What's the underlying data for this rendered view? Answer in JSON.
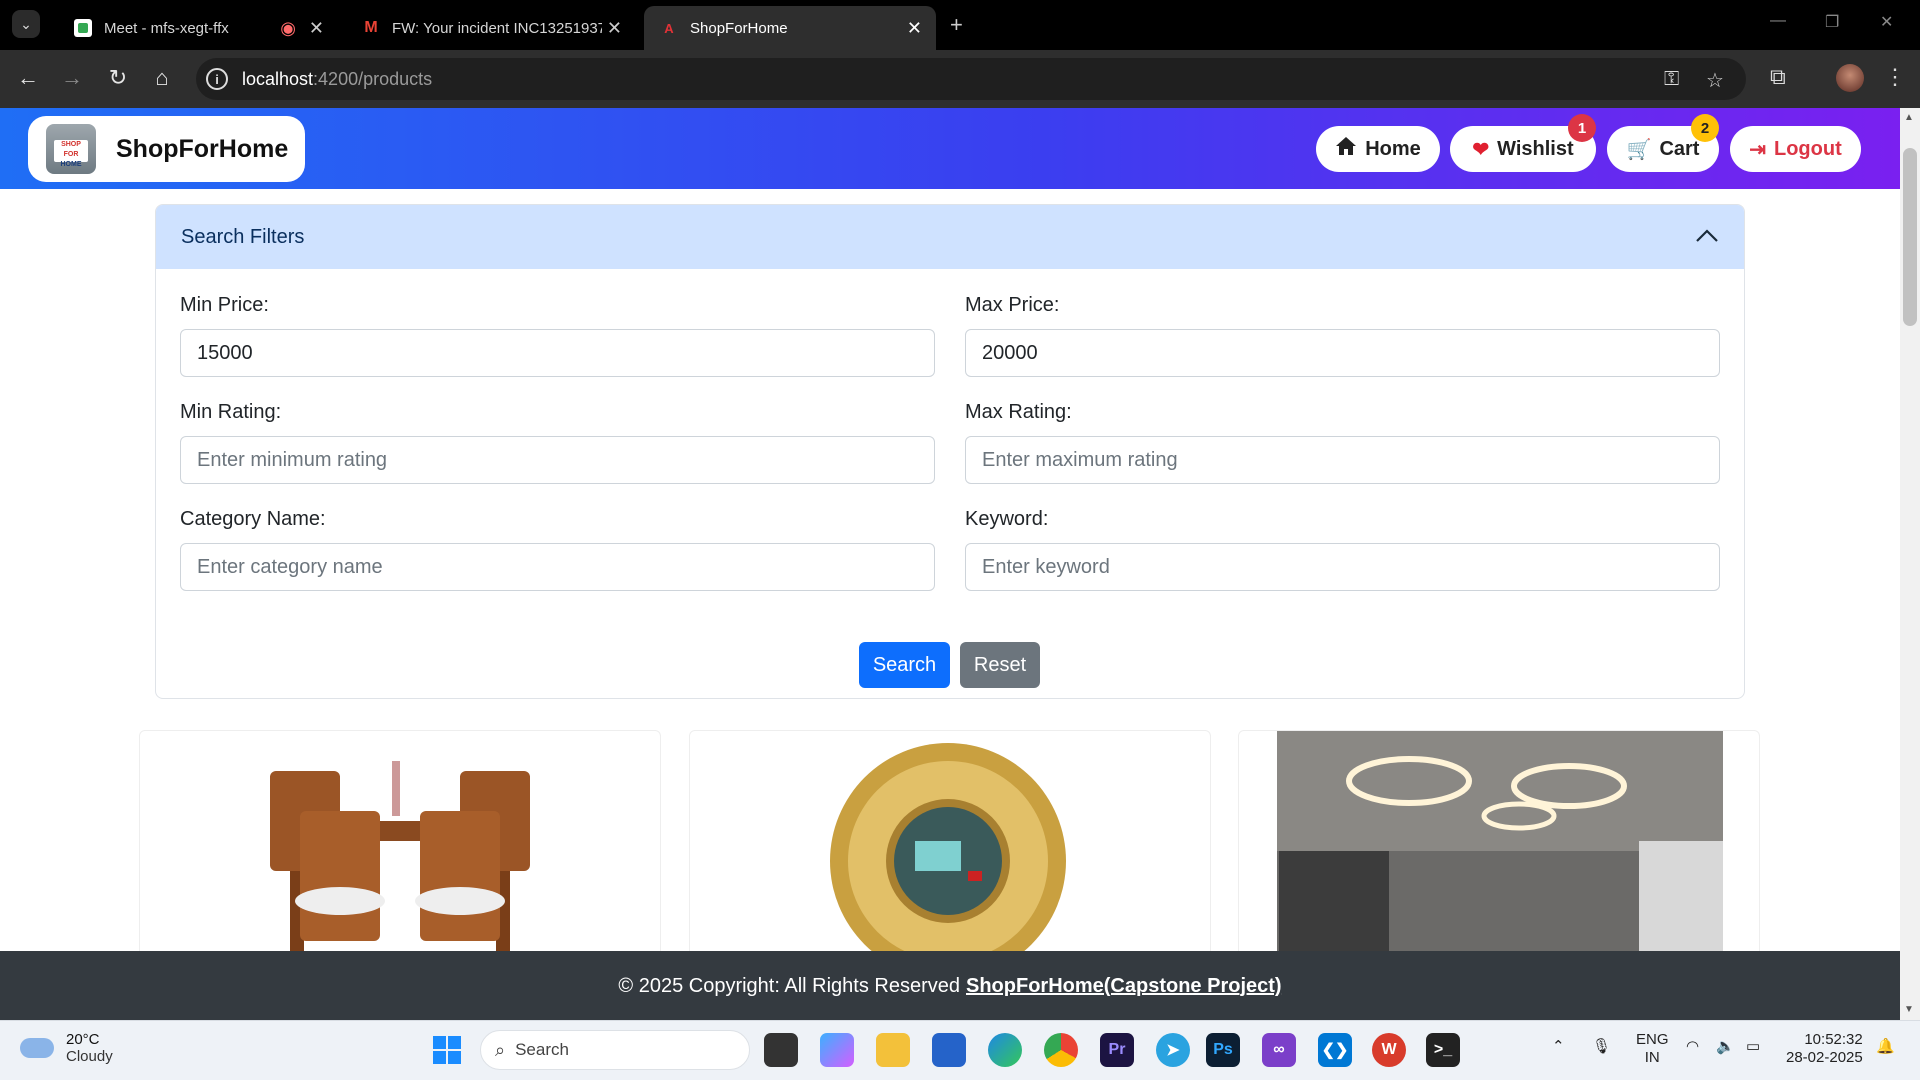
{
  "browser": {
    "tabs": [
      {
        "title": "Meet - mfs-xegt-ffx",
        "active": false
      },
      {
        "title": "FW: Your incident INC13251937",
        "active": false
      },
      {
        "title": "ShopForHome",
        "active": true
      }
    ],
    "url_host": "localhost",
    "url_rest": ":4200/products"
  },
  "header": {
    "brand": "ShopForHome",
    "logo_top": "SHOP FOR",
    "logo_bottom": "HOME",
    "nav": {
      "home": "Home",
      "wishlist": "Wishlist",
      "wishlist_count": "1",
      "cart": "Cart",
      "cart_count": "2",
      "logout": "Logout"
    }
  },
  "filters": {
    "title": "Search Filters",
    "min_price_label": "Min Price:",
    "min_price_value": "15000",
    "max_price_label": "Max Price:",
    "max_price_value": "20000",
    "min_rating_label": "Min Rating:",
    "min_rating_placeholder": "Enter minimum rating",
    "max_rating_label": "Max Rating:",
    "max_rating_placeholder": "Enter maximum rating",
    "category_label": "Category Name:",
    "category_placeholder": "Enter category name",
    "keyword_label": "Keyword:",
    "keyword_placeholder": "Enter keyword",
    "search_button": "Search",
    "reset_button": "Reset"
  },
  "footer": {
    "text": "© 2025 Copyright: All Rights Reserved",
    "link": "ShopForHome(Capstone Project)"
  },
  "taskbar": {
    "temp": "20°C",
    "condition": "Cloudy",
    "search": "Search",
    "lang1": "ENG",
    "lang2": "IN",
    "time": "10:52:32",
    "date": "28-02-2025"
  },
  "colors": {
    "primary": "#0d6efd",
    "secondary": "#6c757d",
    "header_gradient_start": "#1f6ef5",
    "header_gradient_end": "#7a20f0",
    "filter_header_bg": "#cfe2ff",
    "footer_bg": "#343a40"
  }
}
